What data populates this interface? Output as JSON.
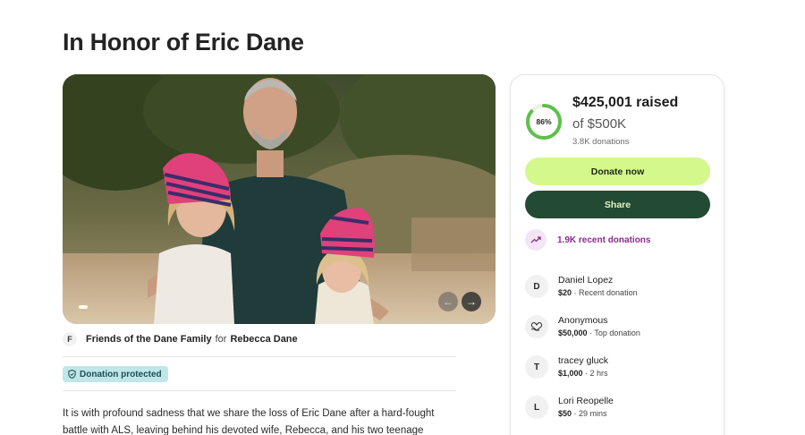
{
  "page": {
    "title": "In Honor of Eric Dane"
  },
  "organizer": {
    "avatar_letter": "F",
    "name": "Friends of the Dane Family",
    "for_text": "for",
    "beneficiary": "Rebecca Dane"
  },
  "badge": {
    "label": "Donation protected"
  },
  "story": {
    "text": "It is with profound sadness that we share the loss of Eric Dane after a hard-fought battle with ALS, leaving behind his devoted wife, Rebecca, and his two teenage daughters, Billie"
  },
  "donation_card": {
    "percent_label": "86%",
    "percent_value": 0.86,
    "raised": "$425,001 raised",
    "goal": "of $500K",
    "donation_count": "3.8K donations",
    "donate_label": "Donate now",
    "share_label": "Share",
    "recent_label": "1.9K recent donations",
    "colors": {
      "progress": "#5fbf4a",
      "donate": "#d4f88c",
      "share": "#234a33",
      "recent": "#8a2c8f"
    }
  },
  "donors": [
    {
      "avatar": "D",
      "icon": null,
      "name": "Daniel Lopez",
      "amount": "$20",
      "note": " · Recent donation"
    },
    {
      "avatar": "",
      "icon": "heart-hand-icon",
      "name": "Anonymous",
      "amount": "$50,000",
      "note": " · Top donation"
    },
    {
      "avatar": "T",
      "icon": null,
      "name": "tracey gluck",
      "amount": "$1,000",
      "note": " · 2 hrs"
    },
    {
      "avatar": "L",
      "icon": null,
      "name": "Lori Reopelle",
      "amount": "$50",
      "note": " · 29 mins"
    }
  ]
}
